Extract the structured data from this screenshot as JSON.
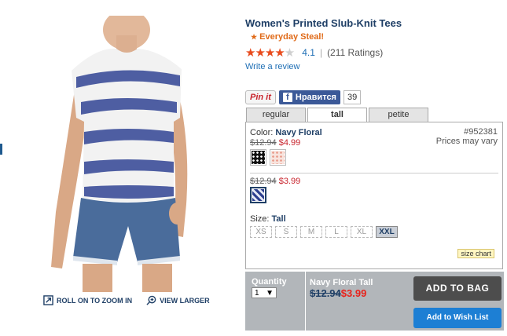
{
  "product": {
    "title": "Women's Printed Slub-Knit Tees",
    "badge": "Everyday Steal!",
    "rating_value": "4.1",
    "rating_stars": 4.1,
    "rating_count": "(211 Ratings)",
    "write_review": "Write a review",
    "item_number": "#952381",
    "prices_note": "Prices may vary"
  },
  "image_tools": {
    "zoom": "ROLL ON TO ZOOM IN",
    "view_larger": "VIEW LARGER"
  },
  "social": {
    "pinit": "Pin it",
    "facebook": "Нравится",
    "facebook_count": "39"
  },
  "tabs": [
    {
      "label": "regular"
    },
    {
      "label": "tall"
    },
    {
      "label": "petite"
    }
  ],
  "colors": {
    "label": "Color:",
    "selected": "Navy Floral",
    "group1": {
      "old_price": "$12.94",
      "new_price": "$4.99"
    },
    "group2": {
      "old_price": "$12.94",
      "new_price": "$3.99"
    }
  },
  "sizes": {
    "label": "Size:",
    "selected": "Tall",
    "options": [
      "XS",
      "S",
      "M",
      "L",
      "XL",
      "XXL"
    ],
    "selected_option": "XXL",
    "size_chart": "size chart"
  },
  "bag": {
    "quantity_label": "Quantity",
    "quantity_value": "1",
    "item_name": "Navy Floral Tall",
    "old_price": "$12.94",
    "new_price": "$3.99",
    "add_to_bag": "ADD TO BAG",
    "add_to_wishlist": "Add to Wish List"
  },
  "colors_theme": {
    "title_navy": "#1f3f66",
    "link_blue": "#1f6fb5",
    "sale_red": "#c8232c",
    "steal_orange": "#e06a18",
    "star_red": "#e84b1d",
    "bag_button": "#4d4d4d",
    "wish_button": "#1d7fd4",
    "bag_bar": "#b2b6ba"
  }
}
